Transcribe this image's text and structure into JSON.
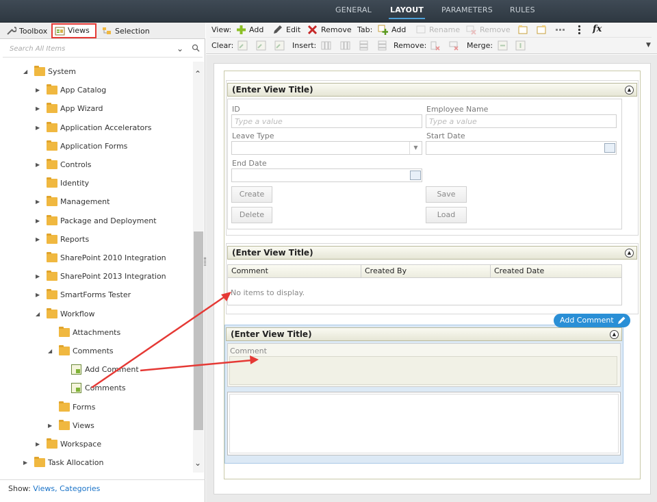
{
  "topbar": {
    "tabs": [
      {
        "label": "GENERAL"
      },
      {
        "label": "LAYOUT"
      },
      {
        "label": "PARAMETERS"
      },
      {
        "label": "RULES"
      }
    ]
  },
  "leftpanel": {
    "tabs": [
      {
        "label": "Toolbox",
        "icon": "wrench-icon"
      },
      {
        "label": "Views",
        "icon": "views-icon"
      },
      {
        "label": "Selection",
        "icon": "selection-icon"
      }
    ],
    "search_placeholder": "Search All Items",
    "tree": [
      {
        "label": "System",
        "icon": "folder-icon",
        "toggle": "open"
      },
      {
        "label": "App Catalog",
        "icon": "folder-icon",
        "toggle": "closed"
      },
      {
        "label": "App Wizard",
        "icon": "folder-icon",
        "toggle": "closed"
      },
      {
        "label": "Application Accelerators",
        "icon": "folder-icon",
        "toggle": "closed"
      },
      {
        "label": "Application Forms",
        "icon": "folder-icon",
        "toggle": "none"
      },
      {
        "label": "Controls",
        "icon": "folder-icon",
        "toggle": "closed"
      },
      {
        "label": "Identity",
        "icon": "folder-icon",
        "toggle": "none"
      },
      {
        "label": "Management",
        "icon": "folder-icon",
        "toggle": "closed"
      },
      {
        "label": "Package and Deployment",
        "icon": "folder-icon",
        "toggle": "closed"
      },
      {
        "label": "Reports",
        "icon": "folder-icon",
        "toggle": "closed"
      },
      {
        "label": "SharePoint 2010 Integration",
        "icon": "folder-icon",
        "toggle": "none"
      },
      {
        "label": "SharePoint 2013 Integration",
        "icon": "folder-icon",
        "toggle": "closed"
      },
      {
        "label": "SmartForms Tester",
        "icon": "folder-icon",
        "toggle": "closed"
      },
      {
        "label": "Workflow",
        "icon": "folder-icon",
        "toggle": "open"
      },
      {
        "label": "Attachments",
        "icon": "folder-icon",
        "toggle": "none"
      },
      {
        "label": "Comments",
        "icon": "folder-icon",
        "toggle": "open"
      },
      {
        "label": "Add Comment",
        "icon": "view-icon",
        "toggle": "none"
      },
      {
        "label": "Comments",
        "icon": "view-icon",
        "toggle": "none"
      },
      {
        "label": "Forms",
        "icon": "folder-icon",
        "toggle": "none"
      },
      {
        "label": "Views",
        "icon": "folder-icon",
        "toggle": "closed"
      },
      {
        "label": "Workspace",
        "icon": "folder-icon",
        "toggle": "closed"
      },
      {
        "label": "Task Allocation",
        "icon": "folder-icon",
        "toggle": "closed"
      }
    ],
    "show_label": "Show:",
    "show_links": "Views, Categories"
  },
  "toolbar": {
    "row1": {
      "view_label": "View:",
      "add": "Add",
      "edit": "Edit",
      "remove": "Remove",
      "tab_label": "Tab:",
      "tab_add": "Add",
      "tab_rename": "Rename",
      "tab_remove": "Remove",
      "fx": "fx"
    },
    "row2": {
      "clear_label": "Clear:",
      "insert_label": "Insert:",
      "remove_label": "Remove:",
      "merge_label": "Merge:"
    }
  },
  "canvas": {
    "view1": {
      "title": "(Enter View Title)",
      "fields": {
        "id_label": "ID",
        "id_placeholder": "Type a value",
        "emp_label": "Employee Name",
        "emp_placeholder": "Type a value",
        "leave_label": "Leave Type",
        "start_label": "Start Date",
        "end_label": "End Date"
      },
      "buttons": {
        "create": "Create",
        "save": "Save",
        "delete": "Delete",
        "load": "Load"
      }
    },
    "view2": {
      "title": "(Enter View Title)",
      "columns": [
        "Comment",
        "Created By",
        "Created Date"
      ],
      "empty": "No items to display."
    },
    "view3": {
      "title": "(Enter View Title)",
      "comment_label": "Comment",
      "badge": "Add Comment"
    }
  }
}
